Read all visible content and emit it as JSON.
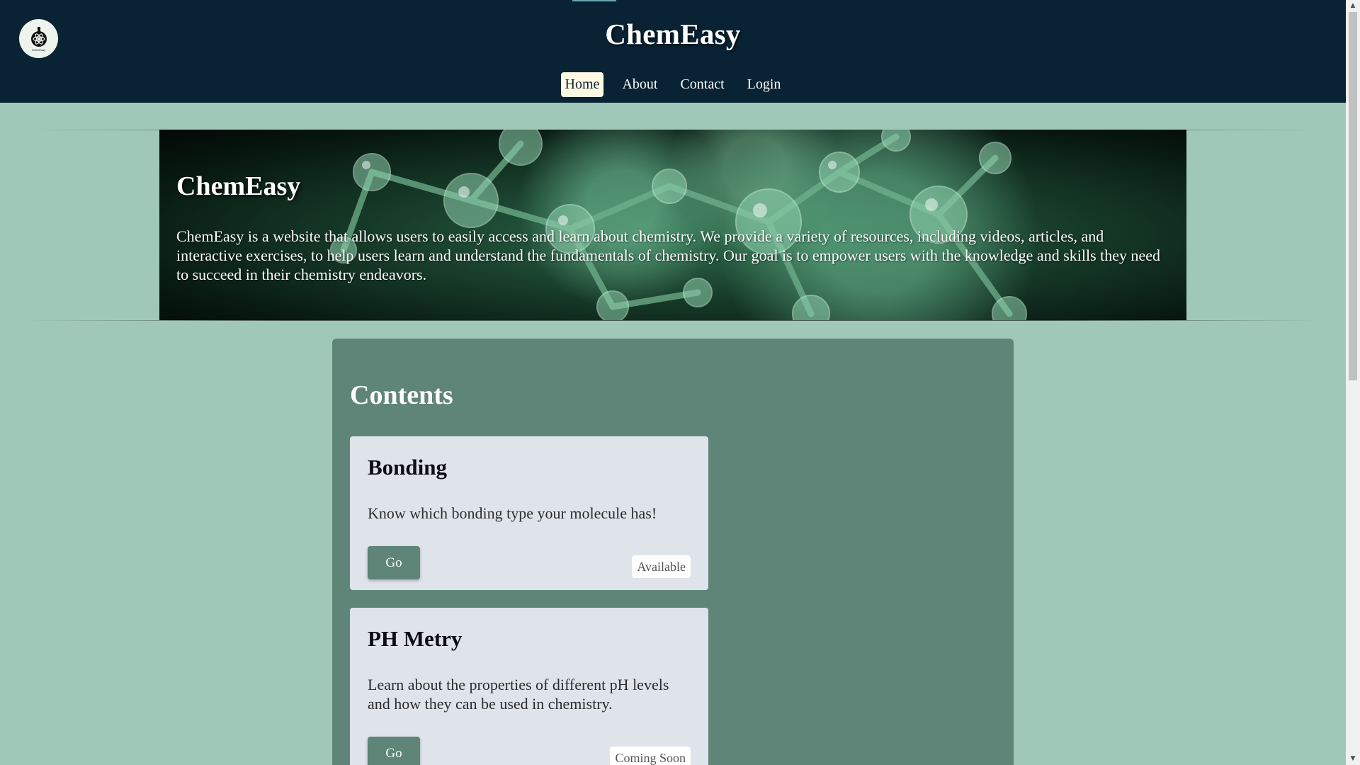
{
  "header": {
    "site_title": "ChemEasy",
    "logo_caption": "ChemEasy",
    "logo_icon": "flask-atom-icon",
    "nav": [
      {
        "label": "Home",
        "active": true
      },
      {
        "label": "About",
        "active": false
      },
      {
        "label": "Contact",
        "active": false
      },
      {
        "label": "Login",
        "active": false
      }
    ]
  },
  "hero": {
    "title": "ChemEasy",
    "description": "ChemEasy is a website that allows users to easily access and learn about chemistry. We provide a variety of resources, including videos, articles, and interactive exercises, to help users learn and understand the fundamentals of chemistry. Our goal is to empower users with the knowledge and skills they need to succeed in their chemistry endeavors."
  },
  "contents": {
    "title": "Contents",
    "cards": [
      {
        "title": "Bonding",
        "description": "Know which bonding type your molecule has!",
        "button_label": "Go",
        "status": "Available"
      },
      {
        "title": "PH Metry",
        "description": "Learn about the properties of different pH levels and how they can be used in chemistry.",
        "button_label": "Go",
        "status": "Coming Soon"
      }
    ]
  },
  "colors": {
    "header_bg": "#092334",
    "page_bg": "#9fc8b9",
    "panel_bg": "#5e8577",
    "card_bg": "#dfe4ea",
    "active_nav_bg": "#fff9e3"
  }
}
